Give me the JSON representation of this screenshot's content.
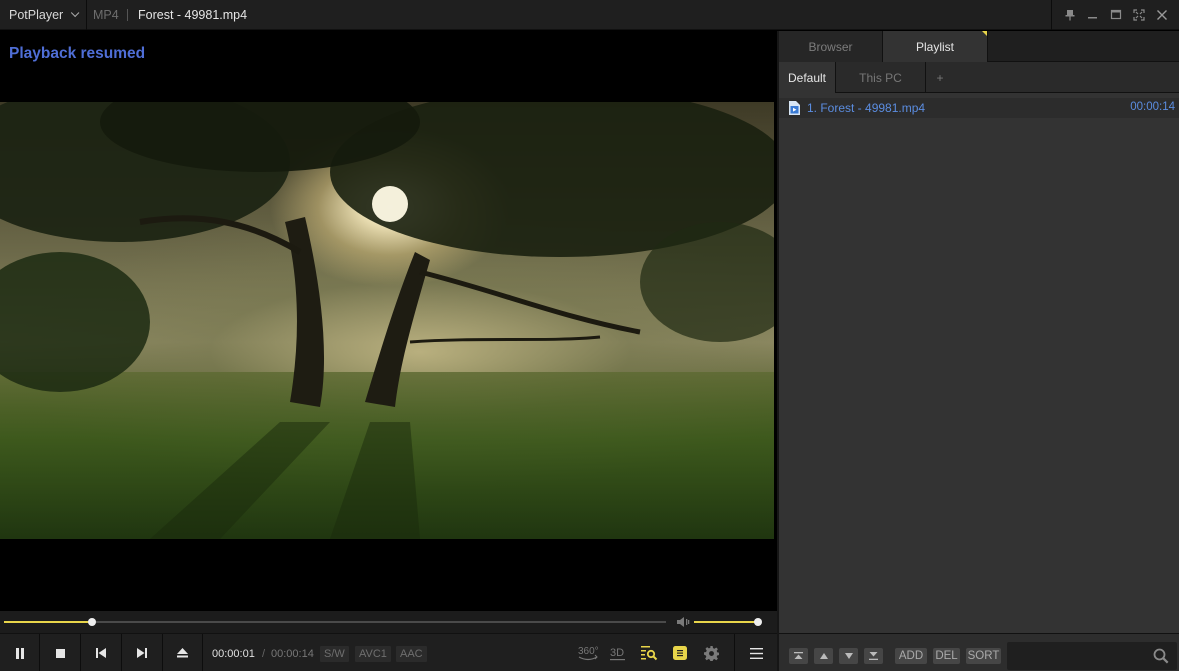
{
  "titlebar": {
    "app_name": "PotPlayer",
    "format": "MP4",
    "file_title": "Forest - 49981.mp4",
    "window_controls": [
      "pin-icon",
      "minimize-icon",
      "maximize-icon",
      "fullscreen-icon",
      "close-icon"
    ]
  },
  "video": {
    "osd_message": "Playback resumed",
    "osd_color": "#4f6ed6"
  },
  "seek": {
    "progress_fraction": 0.133,
    "volume_fraction": 1.0,
    "accent_color": "#e8d54a"
  },
  "controls": {
    "buttons": [
      "pause-icon",
      "stop-icon",
      "previous-icon",
      "next-icon",
      "eject-icon"
    ],
    "time_current": "00:00:01",
    "time_separator": "/",
    "time_total": "00:00:14",
    "badges": [
      "S/W",
      "AVC1",
      "AAC"
    ],
    "right_icons": {
      "vr360": "360°",
      "three_d": "3D"
    }
  },
  "panel": {
    "tabs": [
      "Browser",
      "Playlist"
    ],
    "active_tab": "Playlist",
    "sub_tabs": [
      "Default",
      "This PC",
      "+"
    ],
    "active_sub_tab": "Default",
    "playlist": [
      {
        "title": "1. Forest - 49981.mp4",
        "duration": "00:00:14"
      }
    ],
    "bottom_buttons": [
      "ADD",
      "DEL",
      "SORT"
    ],
    "search_placeholder": ""
  }
}
